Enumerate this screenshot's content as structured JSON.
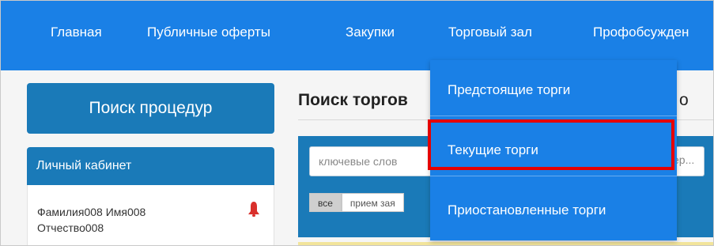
{
  "topnav": {
    "items": [
      "Главная",
      "Публичные оферты",
      "Закупки",
      "Торговый зал",
      "Профобсужден"
    ]
  },
  "dropdown": {
    "items": [
      "Предстоящие торги",
      "Текущие торги",
      "Приостановленные торги"
    ],
    "highlighted_index": 1,
    "highlight_color": "#e50000"
  },
  "sidebar": {
    "search_button": "Поиск процедур",
    "cabinet_title": "Личный кабинет",
    "user_name": "Фамилия008 Имя008 Отчество008",
    "bell_icon": "bell-icon"
  },
  "main": {
    "title_visible": "Поиск торгов",
    "title_tail": "о",
    "keyword_placeholder_start": "ключевые слов",
    "keyword_placeholder_end": "ер...",
    "filter_tabs": [
      "все",
      "прием зая"
    ]
  },
  "colors": {
    "nav_blue": "#1a80e6",
    "panel_blue": "#1a7ab8",
    "highlight_red": "#e50000"
  }
}
